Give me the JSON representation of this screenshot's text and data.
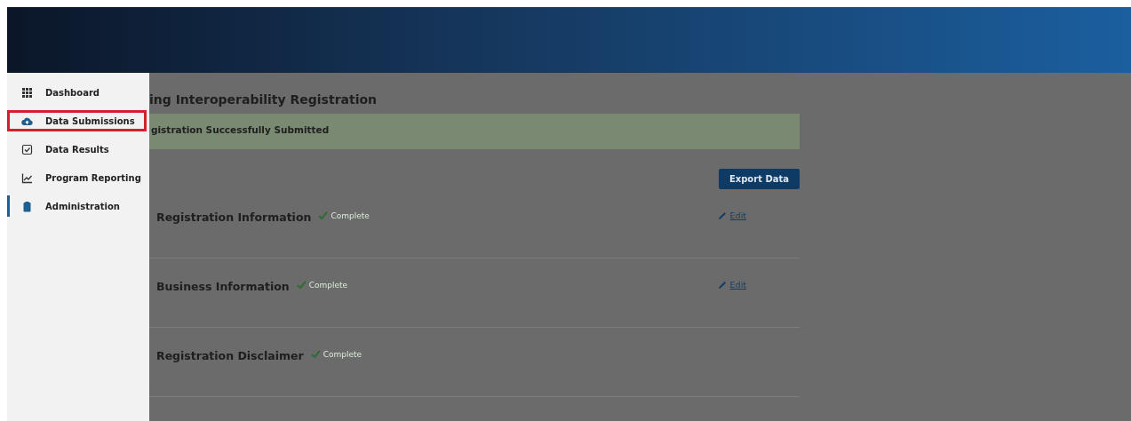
{
  "sidebar": {
    "items": [
      {
        "label": "Dashboard",
        "selected": false,
        "outlined": false
      },
      {
        "label": "Data Submissions",
        "selected": false,
        "outlined": true
      },
      {
        "label": "Data Results",
        "selected": false,
        "outlined": false
      },
      {
        "label": "Program Reporting",
        "selected": false,
        "outlined": false
      },
      {
        "label": "Administration",
        "selected": true,
        "outlined": false
      }
    ]
  },
  "page": {
    "title": "ing Interoperability Registration",
    "banner": "gistration Successfully Submitted",
    "export_button": "Export Data",
    "sections": [
      {
        "title": "Registration Information",
        "status": "Complete",
        "action": "Edit"
      },
      {
        "title": "Business Information",
        "status": "Complete",
        "action": "Edit"
      },
      {
        "title": "Registration Disclaimer",
        "status": "Complete"
      }
    ]
  }
}
